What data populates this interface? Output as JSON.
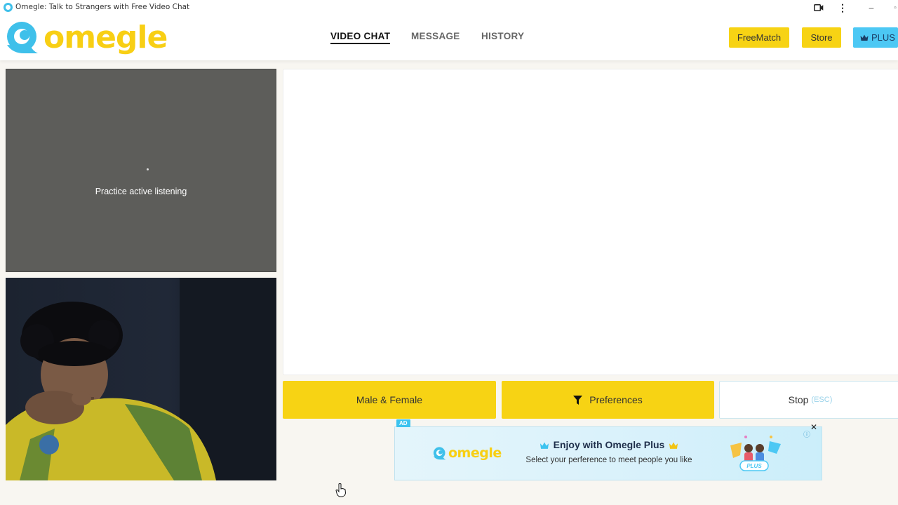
{
  "window": {
    "title": "Omegle: Talk to Strangers with Free Video Chat",
    "icons": [
      "app-icon",
      "video-camera-icon",
      "more-vert-icon",
      "minimize-icon",
      "maximize-icon"
    ]
  },
  "header": {
    "logo_text": "omegle",
    "nav": [
      {
        "label": "VIDEO CHAT",
        "active": true
      },
      {
        "label": "MESSAGE",
        "active": false
      },
      {
        "label": "HISTORY",
        "active": false
      }
    ],
    "buttons": {
      "freematch": "FreeMatch",
      "store": "Store",
      "plus": "PLUS"
    }
  },
  "video": {
    "stranger_status": "Practice active listening"
  },
  "controls": {
    "gender": "Male & Female",
    "preferences": "Preferences",
    "stop": "Stop",
    "stop_hint": "(ESC)"
  },
  "ad": {
    "badge": "AD",
    "logo_text": "omegle",
    "headline": "Enjoy with Omegle Plus",
    "subtext": "Select your perference to meet people you like",
    "art_label": "PLUS"
  },
  "colors": {
    "brand_yellow": "#f7d314",
    "brand_blue": "#3fc0ea",
    "video_placeholder": "#5d5d5a"
  }
}
